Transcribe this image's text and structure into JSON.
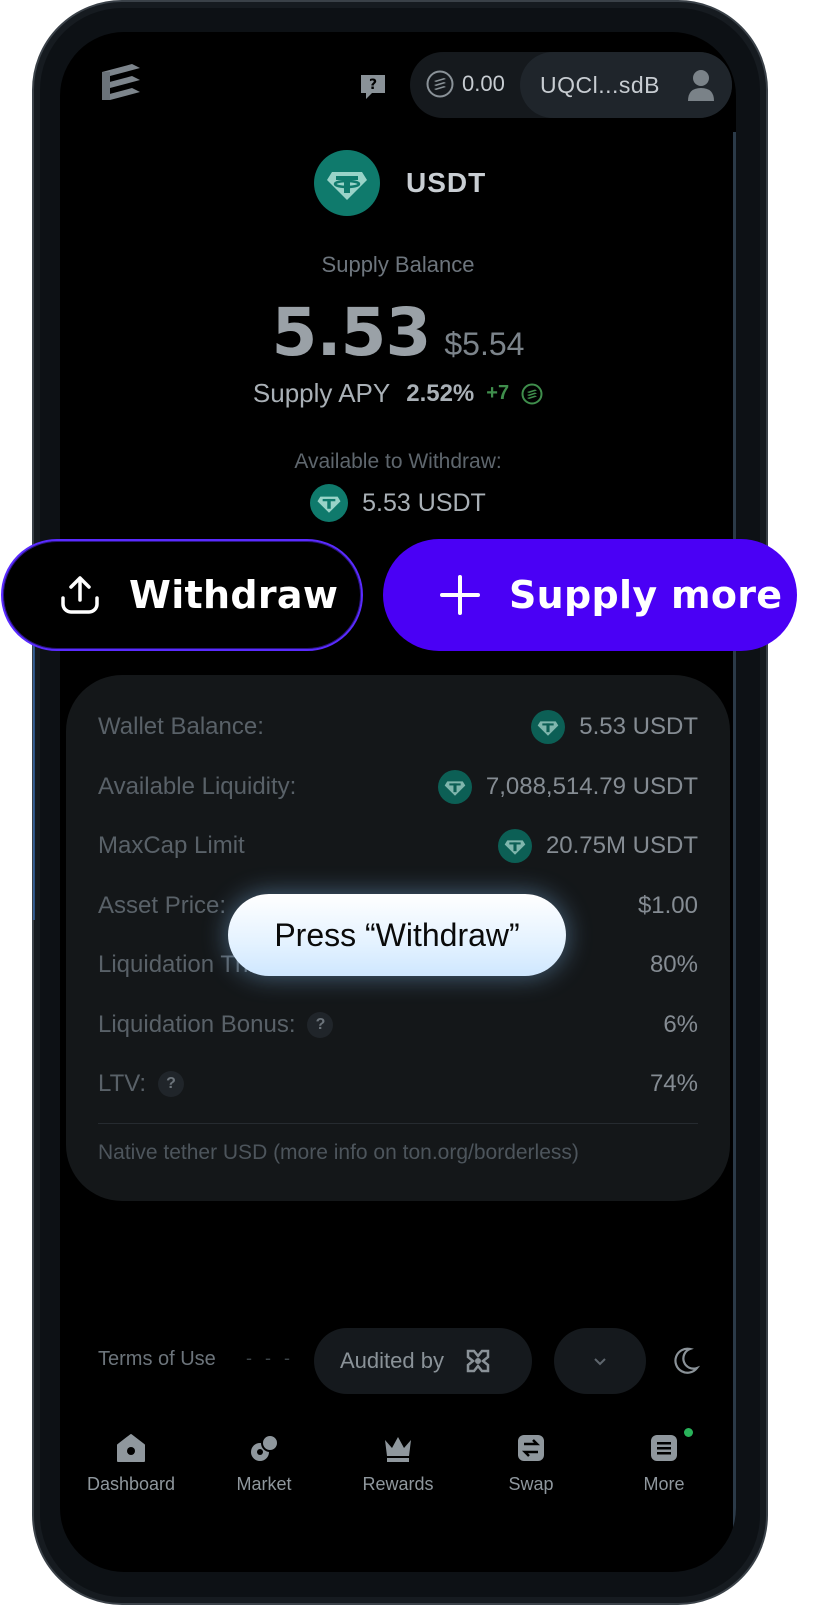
{
  "header": {
    "balance": "0.00",
    "address": "UQCl...sdB"
  },
  "asset": {
    "name": "USDT",
    "supply_balance_label": "Supply Balance",
    "supply_amount": "5.53",
    "supply_usd": "$5.54",
    "apy_label": "Supply APY",
    "apy_value": "2.52%",
    "apy_bonus": "+7",
    "available_label": "Available to Withdraw:",
    "available_value": "5.53 USDT"
  },
  "actions": {
    "withdraw_label": "Withdraw",
    "supply_more_label": "Supply more"
  },
  "info": {
    "rows": [
      {
        "label": "Wallet Balance:",
        "value": "5.53 USDT"
      },
      {
        "label": "Available Liquidity:",
        "value": "7,088,514.79 USDT"
      },
      {
        "label": "MaxCap Limit",
        "value": "20.75M USDT"
      },
      {
        "label": "Asset Price:",
        "value": "$1.00"
      },
      {
        "label": "Liquidation Threshold:",
        "value": "80%"
      },
      {
        "label": "Liquidation Bonus:",
        "value": "6%"
      },
      {
        "label": "LTV:",
        "value": "74%"
      }
    ],
    "note": "Native tether USD (more info on ton.org/borderless)"
  },
  "tooltip": "Press “Withdraw”",
  "footer": {
    "terms": "Terms of Use",
    "dashes": "- - -",
    "audited_by": "Audited by"
  },
  "nav": [
    {
      "label": "Dashboard",
      "icon": "home-icon"
    },
    {
      "label": "Market",
      "icon": "market-icon"
    },
    {
      "label": "Rewards",
      "icon": "crown-icon"
    },
    {
      "label": "Swap",
      "icon": "swap-icon"
    },
    {
      "label": "More",
      "icon": "menu-icon"
    }
  ],
  "colors": {
    "accent": "#4a00f5",
    "tether": "#0f7a6c",
    "online_dot": "#29b35a"
  }
}
